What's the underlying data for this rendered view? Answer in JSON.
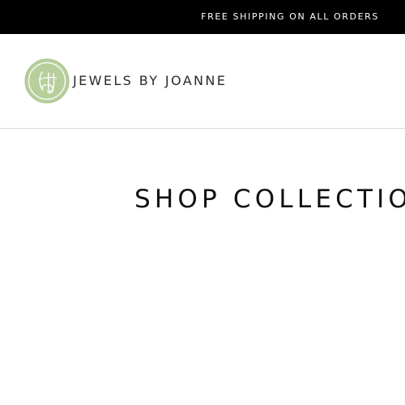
{
  "announcement": {
    "text": "FREE SHIPPING ON ALL ORDERS"
  },
  "header": {
    "logo": {
      "monogram": "JbJ",
      "text": "JEWELS BY JOANNE",
      "icon": "jbj-monogram-logo-icon"
    }
  },
  "main": {
    "title": "SHOP COLLECTIO"
  },
  "colors": {
    "announcement_bg": "#000000",
    "logo_green": "#b7cf9b",
    "divider": "#d9d9d9"
  }
}
